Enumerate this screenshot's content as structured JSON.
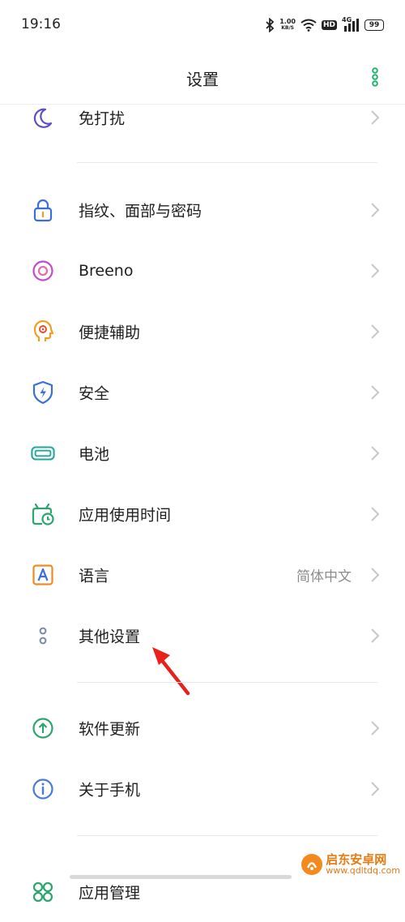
{
  "status": {
    "time": "19:16",
    "net_speed_value": "1.00",
    "net_speed_unit": "KB/S",
    "hd_label": "HD",
    "signal_label": "4G",
    "battery": "99"
  },
  "header": {
    "title": "设置"
  },
  "rows": {
    "dnd": {
      "label": "免打扰"
    },
    "fingerprint": {
      "label": "指纹、面部与密码"
    },
    "breeno": {
      "label": "Breeno"
    },
    "accessibility": {
      "label": "便捷辅助"
    },
    "security": {
      "label": "安全"
    },
    "battery": {
      "label": "电池"
    },
    "screen_time": {
      "label": "应用使用时间"
    },
    "language": {
      "label": "语言",
      "value": "简体中文"
    },
    "other": {
      "label": "其他设置"
    },
    "update": {
      "label": "软件更新"
    },
    "about": {
      "label": "关于手机"
    },
    "apps": {
      "label": "应用管理"
    }
  },
  "watermark": {
    "name": "启东安卓网",
    "url": "www.qdltdq.com"
  },
  "colors": {
    "moon": "#5b4fc8",
    "lock": "#3b6fd8",
    "breeno": "#c04bd0",
    "accessibility": "#f0a020",
    "shield": "#3b6fd8",
    "battery": "#1fa898",
    "screen_time": "#2ca56c",
    "language": "#f08a24",
    "other": "#7a8aa0",
    "update": "#2ca56c",
    "about": "#4a7ad8",
    "apps": "#2ca56c",
    "accent": "#23b26d",
    "annotation": "#e8211d"
  },
  "icons": [
    "moon-icon",
    "lock-icon",
    "breeno-icon",
    "accessibility-icon",
    "shield-icon",
    "battery-icon",
    "clock-icon",
    "language-icon",
    "other-settings-icon",
    "update-icon",
    "info-icon",
    "apps-icon"
  ]
}
